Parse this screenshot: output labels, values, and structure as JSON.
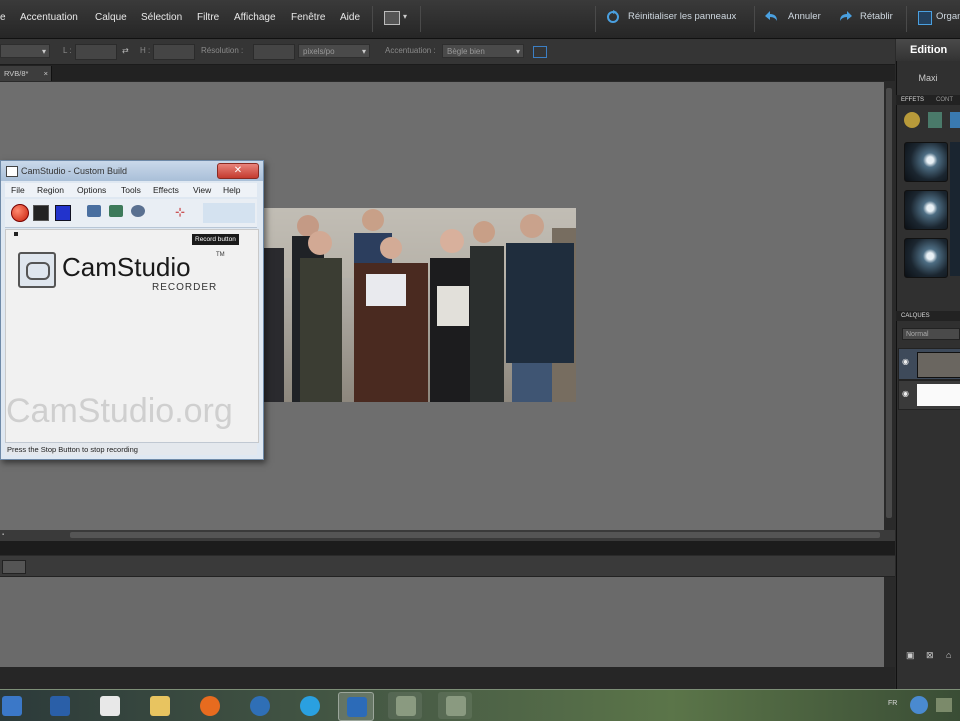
{
  "menubar": {
    "items": [
      "Accentuation",
      "Calque",
      "Sélection",
      "Filtre",
      "Affichage",
      "Fenêtre",
      "Aide"
    ],
    "actions": {
      "reset_panels": "Réinitialiser les panneaux",
      "undo": "Annuler",
      "redo": "Rétablir",
      "organizer": "Organ"
    }
  },
  "options_bar": {
    "resolution_label": "Résolution :",
    "resolution_unit": "pixels/po",
    "smoothing_label": "Accentuation :",
    "smoothing_value": "Bègle bien"
  },
  "document": {
    "tab_label": "RVB/8*"
  },
  "right_panel": {
    "edit_tab": "Edition",
    "mode": "Maxi",
    "effects_tabs": [
      "EFFETS",
      "CONT"
    ],
    "layers_tab": "CALQUES",
    "blend_mode": "Normal"
  },
  "camstudio": {
    "title": "CamStudio - Custom Build",
    "menu": [
      "File",
      "Region",
      "Options",
      "Tools",
      "Effects",
      "View",
      "Help"
    ],
    "tooltip": "Record button",
    "logo_text": "CamStudio",
    "logo_tm": "TM",
    "logo_sub": "RECORDER",
    "watermark": "CamStudio.org",
    "status": "Press the Stop Button to stop recording",
    "close_glyph": "✕"
  },
  "taskbar": {
    "locale": "FR"
  },
  "colors": {
    "canvas": "#6e6e6e",
    "accent_blue": "#3c7fc4",
    "window_chrome": "#a9bfd8"
  }
}
